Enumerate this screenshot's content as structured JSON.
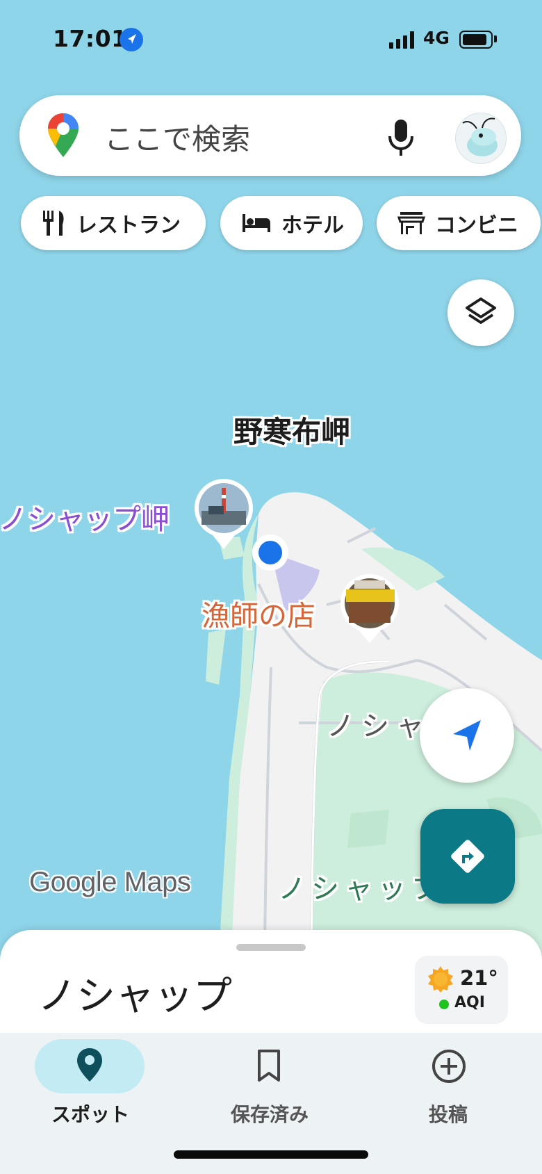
{
  "status": {
    "time": "17:01",
    "network": "4G"
  },
  "search": {
    "placeholder": "ここで検索"
  },
  "chips": [
    {
      "label": "レストラン",
      "icon": "restaurant-icon"
    },
    {
      "label": "ホテル",
      "icon": "bed-icon"
    },
    {
      "label": "コンビニ",
      "icon": "store-icon"
    }
  ],
  "map": {
    "labels": {
      "cape_main": "野寒布岬",
      "cape_noshappu": "ノシャップ岬",
      "restaurant": "漁師の店",
      "road_1": "ノシャッ",
      "road_2": "ノシャップ"
    },
    "watermark": "Google Maps",
    "colors": {
      "water": "#8fd5ea",
      "land": "#f2f2f3",
      "park": "#cdeedd",
      "location_blue": "#1a73e8",
      "directions_teal": "#0b7a86"
    }
  },
  "sheet": {
    "title": "ノシャップ",
    "temperature": "21°",
    "aqi_label": "AQI"
  },
  "bottom_nav": [
    {
      "label": "スポット",
      "icon": "place-pin-icon",
      "active": true
    },
    {
      "label": "保存済み",
      "icon": "bookmark-icon",
      "active": false
    },
    {
      "label": "投稿",
      "icon": "add-circle-icon",
      "active": false
    }
  ]
}
